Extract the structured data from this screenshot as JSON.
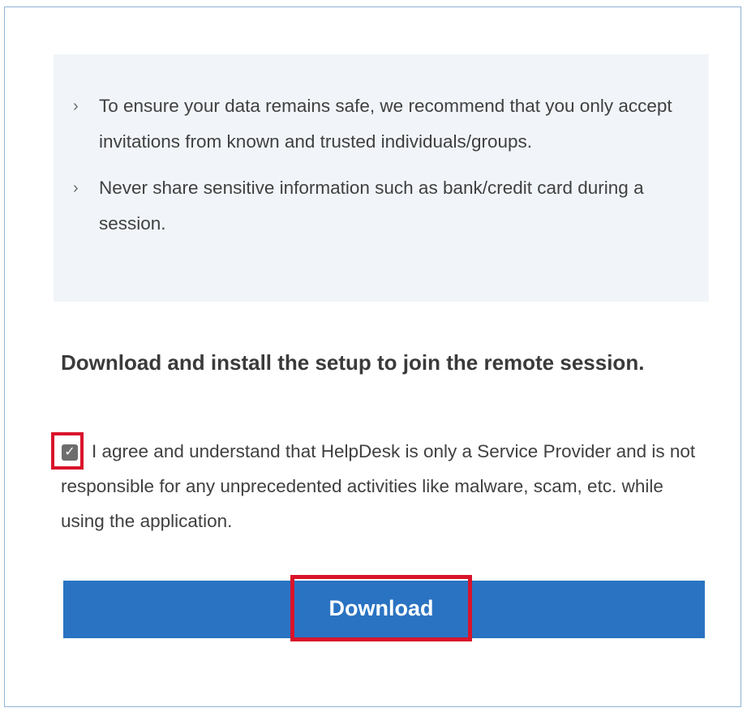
{
  "tips": [
    {
      "text": "To ensure your data remains safe, we recommend that you only accept invitations from known and trusted individuals/groups."
    },
    {
      "text": "Never share sensitive information such as bank/credit card during a session."
    }
  ],
  "heading": "Download and install the setup to join the remote session.",
  "agreement": {
    "checked": true,
    "text": "I agree and understand that HelpDesk is only a Service Provider and is not responsible for any unprecedented activities like malware, scam, etc. while using the application."
  },
  "download": {
    "label": "Download"
  },
  "colors": {
    "button": "#2a73c2",
    "highlight": "#d9142b",
    "tips_background": "#f1f5f9",
    "frame_border": "#8fb3d6"
  },
  "icons": {
    "bullet": "chevron-right-icon",
    "check": "checkmark-icon"
  }
}
